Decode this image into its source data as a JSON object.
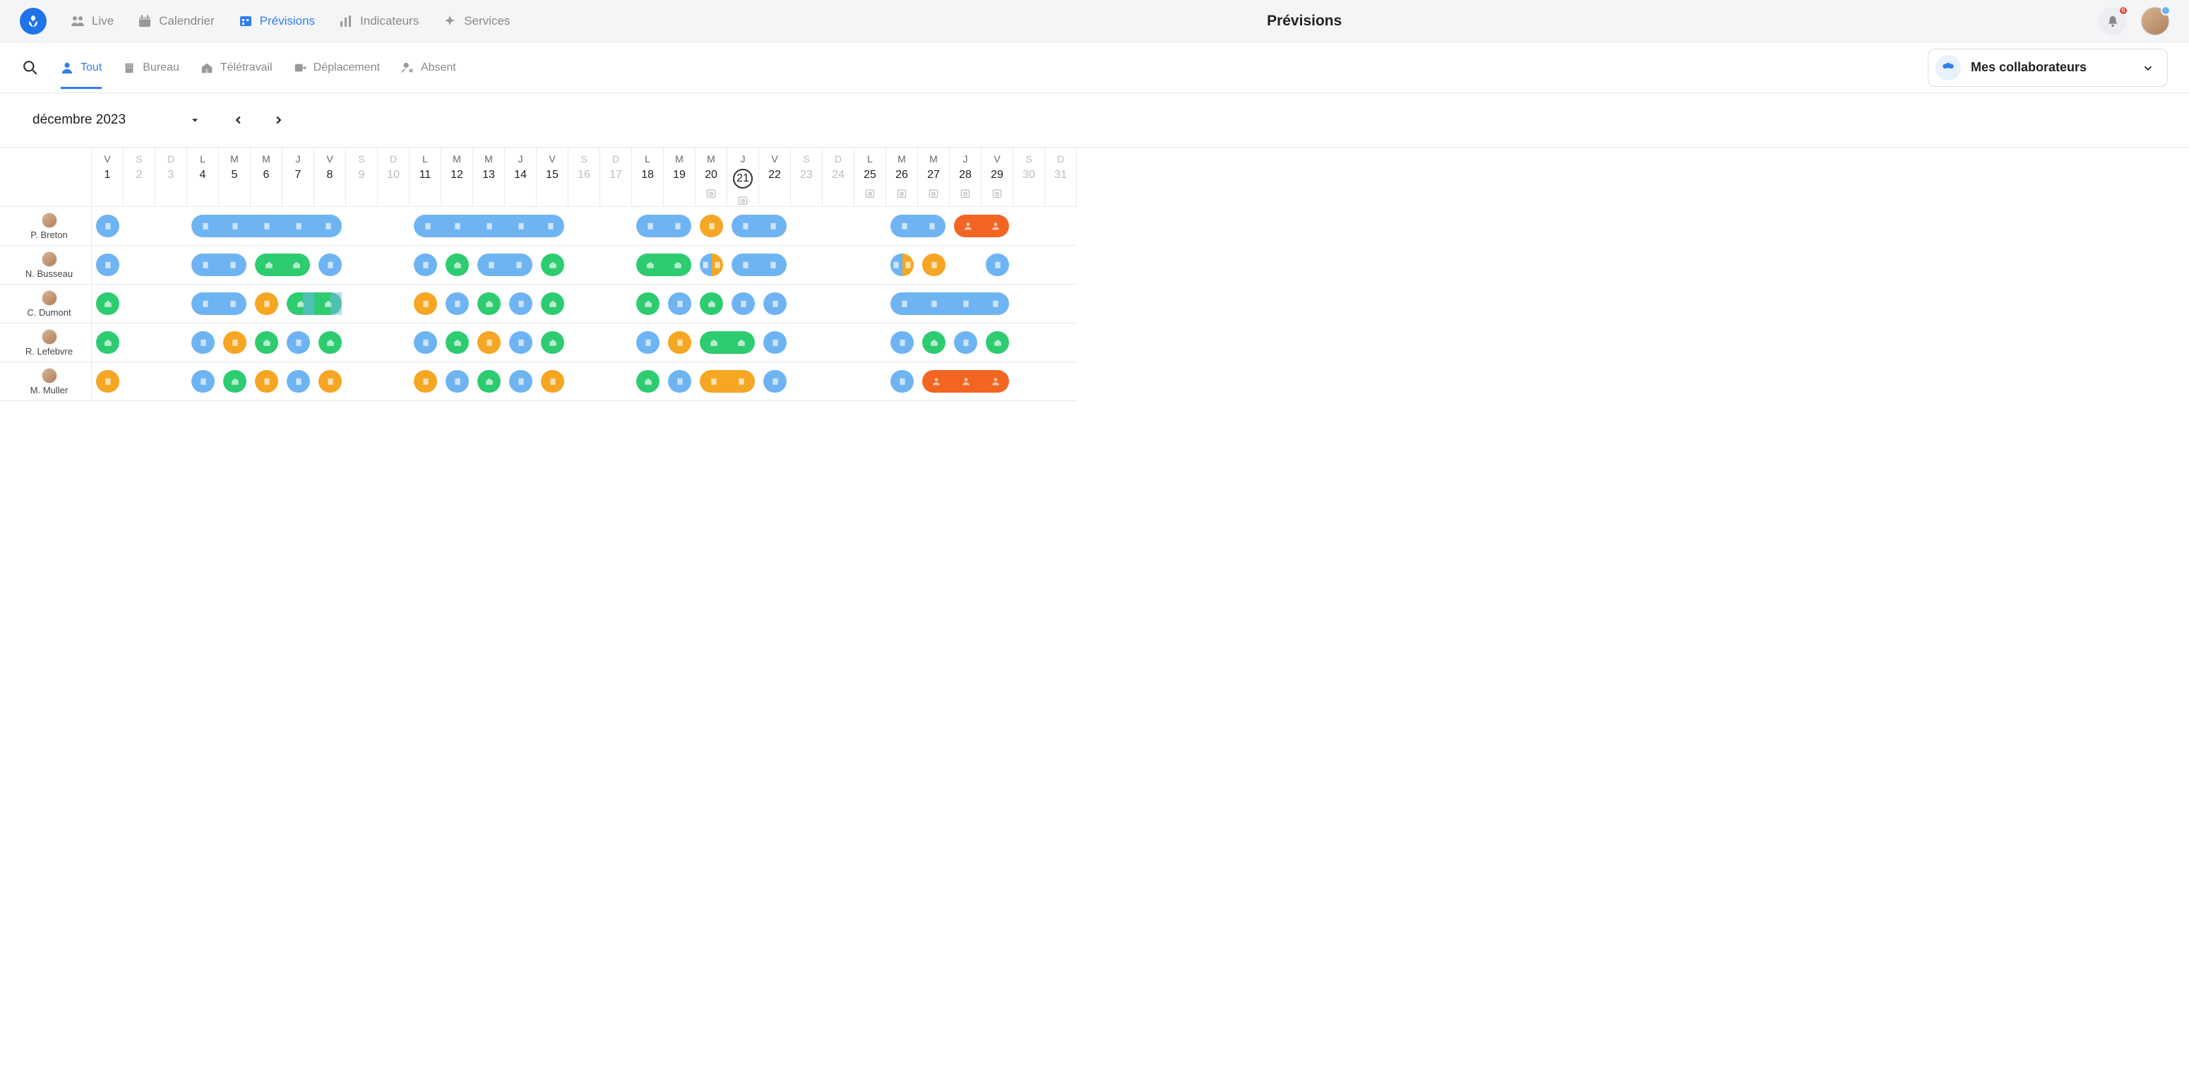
{
  "app": {
    "title": "Prévisions"
  },
  "nav": [
    {
      "id": "live",
      "label": "Live",
      "icon": "people"
    },
    {
      "id": "calendrier",
      "label": "Calendrier",
      "icon": "calendar"
    },
    {
      "id": "previsions",
      "label": "Prévisions",
      "icon": "forecast",
      "active": true
    },
    {
      "id": "indicateurs",
      "label": "Indicateurs",
      "icon": "chart"
    },
    {
      "id": "services",
      "label": "Services",
      "icon": "sparkle"
    }
  ],
  "notifications": {
    "count": 6
  },
  "filter": {
    "tabs": [
      {
        "id": "tout",
        "label": "Tout",
        "icon": "person",
        "active": true
      },
      {
        "id": "bureau",
        "label": "Bureau",
        "icon": "building"
      },
      {
        "id": "teletravail",
        "label": "Télétravail",
        "icon": "home"
      },
      {
        "id": "deplacement",
        "label": "Déplacement",
        "icon": "move"
      },
      {
        "id": "absent",
        "label": "Absent",
        "icon": "person-x"
      }
    ],
    "selector_label": "Mes collaborateurs"
  },
  "month": {
    "label": "décembre 2023",
    "today": 21
  },
  "days": [
    {
      "n": 1,
      "dow": "V"
    },
    {
      "n": 2,
      "dow": "S",
      "weekend": true
    },
    {
      "n": 3,
      "dow": "D",
      "weekend": true
    },
    {
      "n": 4,
      "dow": "L"
    },
    {
      "n": 5,
      "dow": "M"
    },
    {
      "n": 6,
      "dow": "M"
    },
    {
      "n": 7,
      "dow": "J"
    },
    {
      "n": 8,
      "dow": "V"
    },
    {
      "n": 9,
      "dow": "S",
      "weekend": true
    },
    {
      "n": 10,
      "dow": "D",
      "weekend": true
    },
    {
      "n": 11,
      "dow": "L"
    },
    {
      "n": 12,
      "dow": "M"
    },
    {
      "n": 13,
      "dow": "M"
    },
    {
      "n": 14,
      "dow": "J"
    },
    {
      "n": 15,
      "dow": "V"
    },
    {
      "n": 16,
      "dow": "S",
      "weekend": true
    },
    {
      "n": 17,
      "dow": "D",
      "weekend": true
    },
    {
      "n": 18,
      "dow": "L"
    },
    {
      "n": 19,
      "dow": "M"
    },
    {
      "n": 20,
      "dow": "M",
      "reminder": true
    },
    {
      "n": 21,
      "dow": "J",
      "today": true,
      "reminder": true
    },
    {
      "n": 22,
      "dow": "V"
    },
    {
      "n": 23,
      "dow": "S",
      "weekend": true
    },
    {
      "n": 24,
      "dow": "D",
      "weekend": true
    },
    {
      "n": 25,
      "dow": "L",
      "reminder": true
    },
    {
      "n": 26,
      "dow": "M",
      "reminder": true
    },
    {
      "n": 27,
      "dow": "M",
      "reminder": true
    },
    {
      "n": 28,
      "dow": "J",
      "reminder": true
    },
    {
      "n": 29,
      "dow": "V",
      "reminder": true
    },
    {
      "n": 30,
      "dow": "S",
      "weekend": true
    },
    {
      "n": 31,
      "dow": "D",
      "weekend": true
    }
  ],
  "collaborators": [
    {
      "name": "P. Breton",
      "entries": {
        "1": {
          "color": "blue",
          "icon": "building"
        },
        "4": {
          "color": "blue",
          "icon": "building",
          "span": "start"
        },
        "5": {
          "color": "blue",
          "icon": "building",
          "span": "mid"
        },
        "6": {
          "color": "blue",
          "icon": "building",
          "span": "mid"
        },
        "7": {
          "color": "blue",
          "icon": "building",
          "span": "mid"
        },
        "8": {
          "color": "blue",
          "icon": "building",
          "span": "end"
        },
        "11": {
          "color": "blue",
          "icon": "building",
          "span": "start"
        },
        "12": {
          "color": "blue",
          "icon": "building",
          "span": "mid"
        },
        "13": {
          "color": "blue",
          "icon": "building",
          "span": "mid"
        },
        "14": {
          "color": "blue",
          "icon": "building",
          "span": "mid"
        },
        "15": {
          "color": "blue",
          "icon": "building",
          "span": "end"
        },
        "18": {
          "color": "blue",
          "icon": "building",
          "span": "start"
        },
        "19": {
          "color": "blue",
          "icon": "building",
          "span": "end"
        },
        "20": {
          "color": "orange",
          "icon": "building"
        },
        "21": {
          "color": "blue",
          "icon": "building",
          "span": "start"
        },
        "22": {
          "color": "blue",
          "icon": "building",
          "span": "end"
        },
        "26": {
          "color": "blue",
          "icon": "building",
          "span": "start"
        },
        "27": {
          "color": "blue",
          "icon": "building",
          "span": "end"
        },
        "28": {
          "color": "red",
          "icon": "person",
          "span": "start"
        },
        "29": {
          "color": "red",
          "icon": "person",
          "span": "end"
        }
      }
    },
    {
      "name": "N. Busseau",
      "entries": {
        "1": {
          "color": "blue",
          "icon": "building"
        },
        "4": {
          "color": "blue",
          "icon": "building",
          "span": "start"
        },
        "5": {
          "color": "blue",
          "icon": "building",
          "span": "end"
        },
        "6": {
          "color": "green",
          "icon": "home",
          "span": "start"
        },
        "7": {
          "color": "green",
          "icon": "home",
          "span": "end"
        },
        "8": {
          "color": "blue",
          "icon": "building"
        },
        "11": {
          "color": "blue",
          "icon": "building"
        },
        "12": {
          "color": "green",
          "icon": "home"
        },
        "13": {
          "color": "blue",
          "icon": "building",
          "span": "start"
        },
        "14": {
          "color": "blue",
          "icon": "building",
          "span": "end"
        },
        "15": {
          "color": "green",
          "icon": "home"
        },
        "18": {
          "color": "green",
          "icon": "home",
          "span": "start"
        },
        "19": {
          "color": "green",
          "icon": "home",
          "span": "end"
        },
        "20": {
          "split": [
            {
              "color": "blue",
              "icon": "building"
            },
            {
              "color": "orange",
              "icon": "building"
            }
          ]
        },
        "21": {
          "color": "blue",
          "icon": "building",
          "span": "start"
        },
        "22": {
          "color": "blue",
          "icon": "building",
          "span": "end"
        },
        "26": {
          "split": [
            {
              "color": "blue",
              "icon": "building"
            },
            {
              "color": "orange",
              "icon": "building"
            }
          ],
          "span_like": "wide"
        },
        "27": {
          "color": "orange",
          "icon": "building",
          "span": "end_from_split"
        },
        "29": {
          "color": "blue",
          "icon": "building"
        }
      }
    },
    {
      "name": "C. Dumont",
      "entries": {
        "1": {
          "color": "green",
          "icon": "home"
        },
        "4": {
          "color": "blue",
          "icon": "building",
          "span": "start"
        },
        "5": {
          "color": "blue",
          "icon": "building",
          "span": "end"
        },
        "6": {
          "color": "orange",
          "icon": "building"
        },
        "7": {
          "color": "green",
          "icon": "home",
          "span": "start",
          "overlay": "building"
        },
        "8": {
          "color": "green",
          "icon": "home",
          "span": "end",
          "overlay": "building"
        },
        "11": {
          "color": "orange",
          "icon": "building"
        },
        "12": {
          "color": "blue",
          "icon": "building"
        },
        "13": {
          "color": "green",
          "icon": "home"
        },
        "14": {
          "color": "blue",
          "icon": "building"
        },
        "15": {
          "color": "green",
          "icon": "home"
        },
        "18": {
          "color": "green",
          "icon": "home"
        },
        "19": {
          "color": "blue",
          "icon": "building"
        },
        "20": {
          "color": "green",
          "icon": "home"
        },
        "21": {
          "color": "blue",
          "icon": "building"
        },
        "22": {
          "color": "blue",
          "icon": "building"
        },
        "26": {
          "color": "blue",
          "icon": "building",
          "span": "start"
        },
        "27": {
          "color": "blue",
          "icon": "building",
          "span": "mid"
        },
        "28": {
          "color": "blue",
          "icon": "building",
          "span": "mid"
        },
        "29": {
          "color": "blue",
          "icon": "building",
          "span": "end"
        }
      }
    },
    {
      "name": "R. Lefebvre",
      "entries": {
        "1": {
          "color": "green",
          "icon": "home"
        },
        "4": {
          "color": "blue",
          "icon": "building"
        },
        "5": {
          "color": "orange",
          "icon": "building"
        },
        "6": {
          "color": "green",
          "icon": "home"
        },
        "7": {
          "color": "blue",
          "icon": "building"
        },
        "8": {
          "color": "green",
          "icon": "home"
        },
        "11": {
          "color": "blue",
          "icon": "building"
        },
        "12": {
          "color": "green",
          "icon": "home"
        },
        "13": {
          "color": "orange",
          "icon": "building"
        },
        "14": {
          "color": "blue",
          "icon": "building"
        },
        "15": {
          "color": "green",
          "icon": "home"
        },
        "18": {
          "color": "blue",
          "icon": "building"
        },
        "19": {
          "color": "orange",
          "icon": "building"
        },
        "20": {
          "color": "green",
          "icon": "home",
          "span": "start"
        },
        "21": {
          "color": "green",
          "icon": "home",
          "span": "end"
        },
        "22": {
          "color": "blue",
          "icon": "building"
        },
        "26": {
          "color": "blue",
          "icon": "building"
        },
        "27": {
          "color": "green",
          "icon": "home"
        },
        "28": {
          "color": "blue",
          "icon": "building"
        },
        "29": {
          "color": "green",
          "icon": "home"
        }
      }
    },
    {
      "name": "M. Muller",
      "entries": {
        "1": {
          "color": "orange",
          "icon": "building"
        },
        "4": {
          "color": "blue",
          "icon": "building"
        },
        "5": {
          "color": "green",
          "icon": "home"
        },
        "6": {
          "color": "orange",
          "icon": "building"
        },
        "7": {
          "color": "blue",
          "icon": "building"
        },
        "8": {
          "color": "orange",
          "icon": "building"
        },
        "11": {
          "color": "orange",
          "icon": "building"
        },
        "12": {
          "color": "blue",
          "icon": "building"
        },
        "13": {
          "color": "green",
          "icon": "home"
        },
        "14": {
          "color": "blue",
          "icon": "building"
        },
        "15": {
          "color": "orange",
          "icon": "building"
        },
        "18": {
          "color": "green",
          "icon": "home"
        },
        "19": {
          "color": "blue",
          "icon": "building"
        },
        "20": {
          "color": "orange",
          "icon": "building",
          "span": "start"
        },
        "21": {
          "color": "orange",
          "icon": "building",
          "span": "end"
        },
        "22": {
          "color": "blue",
          "icon": "building"
        },
        "26": {
          "color": "blue",
          "icon": "building"
        },
        "27": {
          "color": "red",
          "icon": "person",
          "span": "start"
        },
        "28": {
          "color": "red",
          "icon": "person",
          "span": "mid"
        },
        "29": {
          "color": "red",
          "icon": "person",
          "span": "end"
        }
      }
    }
  ]
}
